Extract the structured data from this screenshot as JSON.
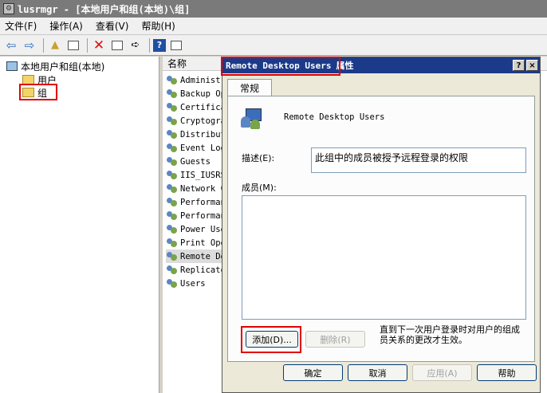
{
  "window": {
    "title": "lusrmgr - [本地用户和组(本地)\\组]"
  },
  "menu": {
    "items": [
      "文件(F)",
      "操作(A)",
      "查看(V)",
      "帮助(H)"
    ]
  },
  "tree": {
    "root": "本地用户和组(本地)",
    "users": "用户",
    "groups": "组"
  },
  "list": {
    "column_name": "名称",
    "items": [
      "Administr",
      "Backup Op",
      "Certifica",
      "Cryptogra",
      "Distribut",
      "Event Log",
      "Guests",
      "IIS_IUSRS",
      "Network C",
      "Performan",
      "Performan",
      "Power Use",
      "Print Ope",
      "Remote De",
      "Replicato",
      "Users"
    ],
    "selected_index": 13
  },
  "dialog": {
    "title_group": "Remote Desktop Users",
    "title_suffix": "属性",
    "help_btn": "?",
    "close_btn": "×",
    "tab_general": "常规",
    "group_name": "Remote Desktop Users",
    "desc_label": "描述(E):",
    "desc_value": "此组中的成员被授予远程登录的权限",
    "members_label": "成员(M):",
    "add_button": "添加(D)...",
    "remove_button": "删除(R)",
    "note": "直到下一次用户登录时对用户的组成员关系的更改才生效。",
    "ok_button": "确定",
    "cancel_button": "取消",
    "apply_button": "应用(A)",
    "help_button": "帮助"
  },
  "colors": {
    "highlight_box": "#e00000",
    "dialog_title_bg": "#1c3a8a",
    "window_title_bg": "#7a7a7a"
  }
}
